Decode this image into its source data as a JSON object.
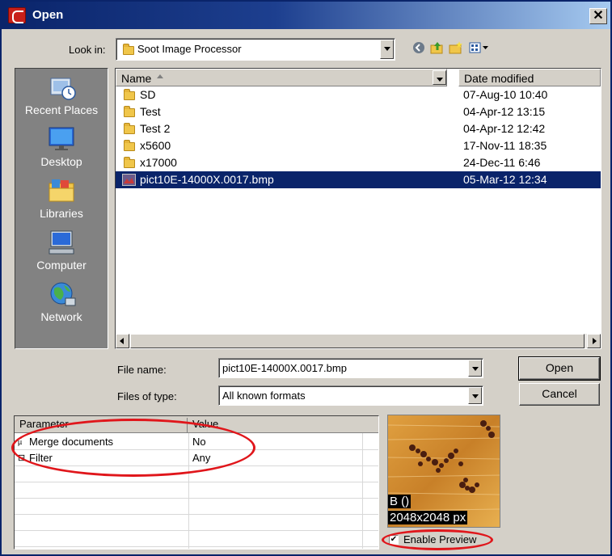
{
  "window": {
    "title": "Open",
    "close_glyph": "✕",
    "app_icon": "app-icon"
  },
  "look_in": {
    "label": "Look in:",
    "value": "Soot Image Processor",
    "toolbar_icons": [
      "back-icon",
      "up-folder-icon",
      "new-folder-icon",
      "view-menu-icon"
    ]
  },
  "places": [
    {
      "label": "Recent Places",
      "icon": "recent-places-icon"
    },
    {
      "label": "Desktop",
      "icon": "desktop-icon"
    },
    {
      "label": "Libraries",
      "icon": "libraries-icon"
    },
    {
      "label": "Computer",
      "icon": "computer-icon"
    },
    {
      "label": "Network",
      "icon": "network-icon"
    }
  ],
  "file_list": {
    "columns": {
      "name": "Name",
      "date": "Date modified"
    },
    "rows": [
      {
        "name": "SD",
        "date": "07-Aug-10 10:40",
        "icon": "folder-icon"
      },
      {
        "name": "Test",
        "date": "04-Apr-12 13:15",
        "icon": "folder-icon"
      },
      {
        "name": "Test 2",
        "date": "04-Apr-12 12:42",
        "icon": "folder-icon"
      },
      {
        "name": "x5600",
        "date": "17-Nov-11 18:35",
        "icon": "folder-icon"
      },
      {
        "name": "x17000",
        "date": "24-Dec-11 6:46",
        "icon": "folder-icon"
      },
      {
        "name": "pict10E-14000X.0017.bmp",
        "date": "05-Mar-12 12:34",
        "icon": "bitmap-file-icon",
        "selected": true
      }
    ]
  },
  "file_name": {
    "label": "File name:",
    "value": "pict10E-14000X.0017.bmp"
  },
  "file_type": {
    "label": "Files of type:",
    "value": "All known formats"
  },
  "buttons": {
    "open": "Open",
    "cancel": "Cancel"
  },
  "params": {
    "headers": {
      "parameter": "Parameter",
      "value": "Value"
    },
    "rows": [
      {
        "icon": "merge-icon",
        "icon_text": "µ́",
        "name": "Merge documents",
        "value": "No"
      },
      {
        "icon": "filter-icon",
        "icon_text": "⊟",
        "name": "Filter",
        "value": "Any"
      }
    ]
  },
  "preview": {
    "line1": "B ()",
    "line2": "2048x2048 px",
    "checkbox_label": "Enable Preview",
    "checked": true
  },
  "annotation_color": "#e0161b",
  "selection_color": "#0a246a"
}
